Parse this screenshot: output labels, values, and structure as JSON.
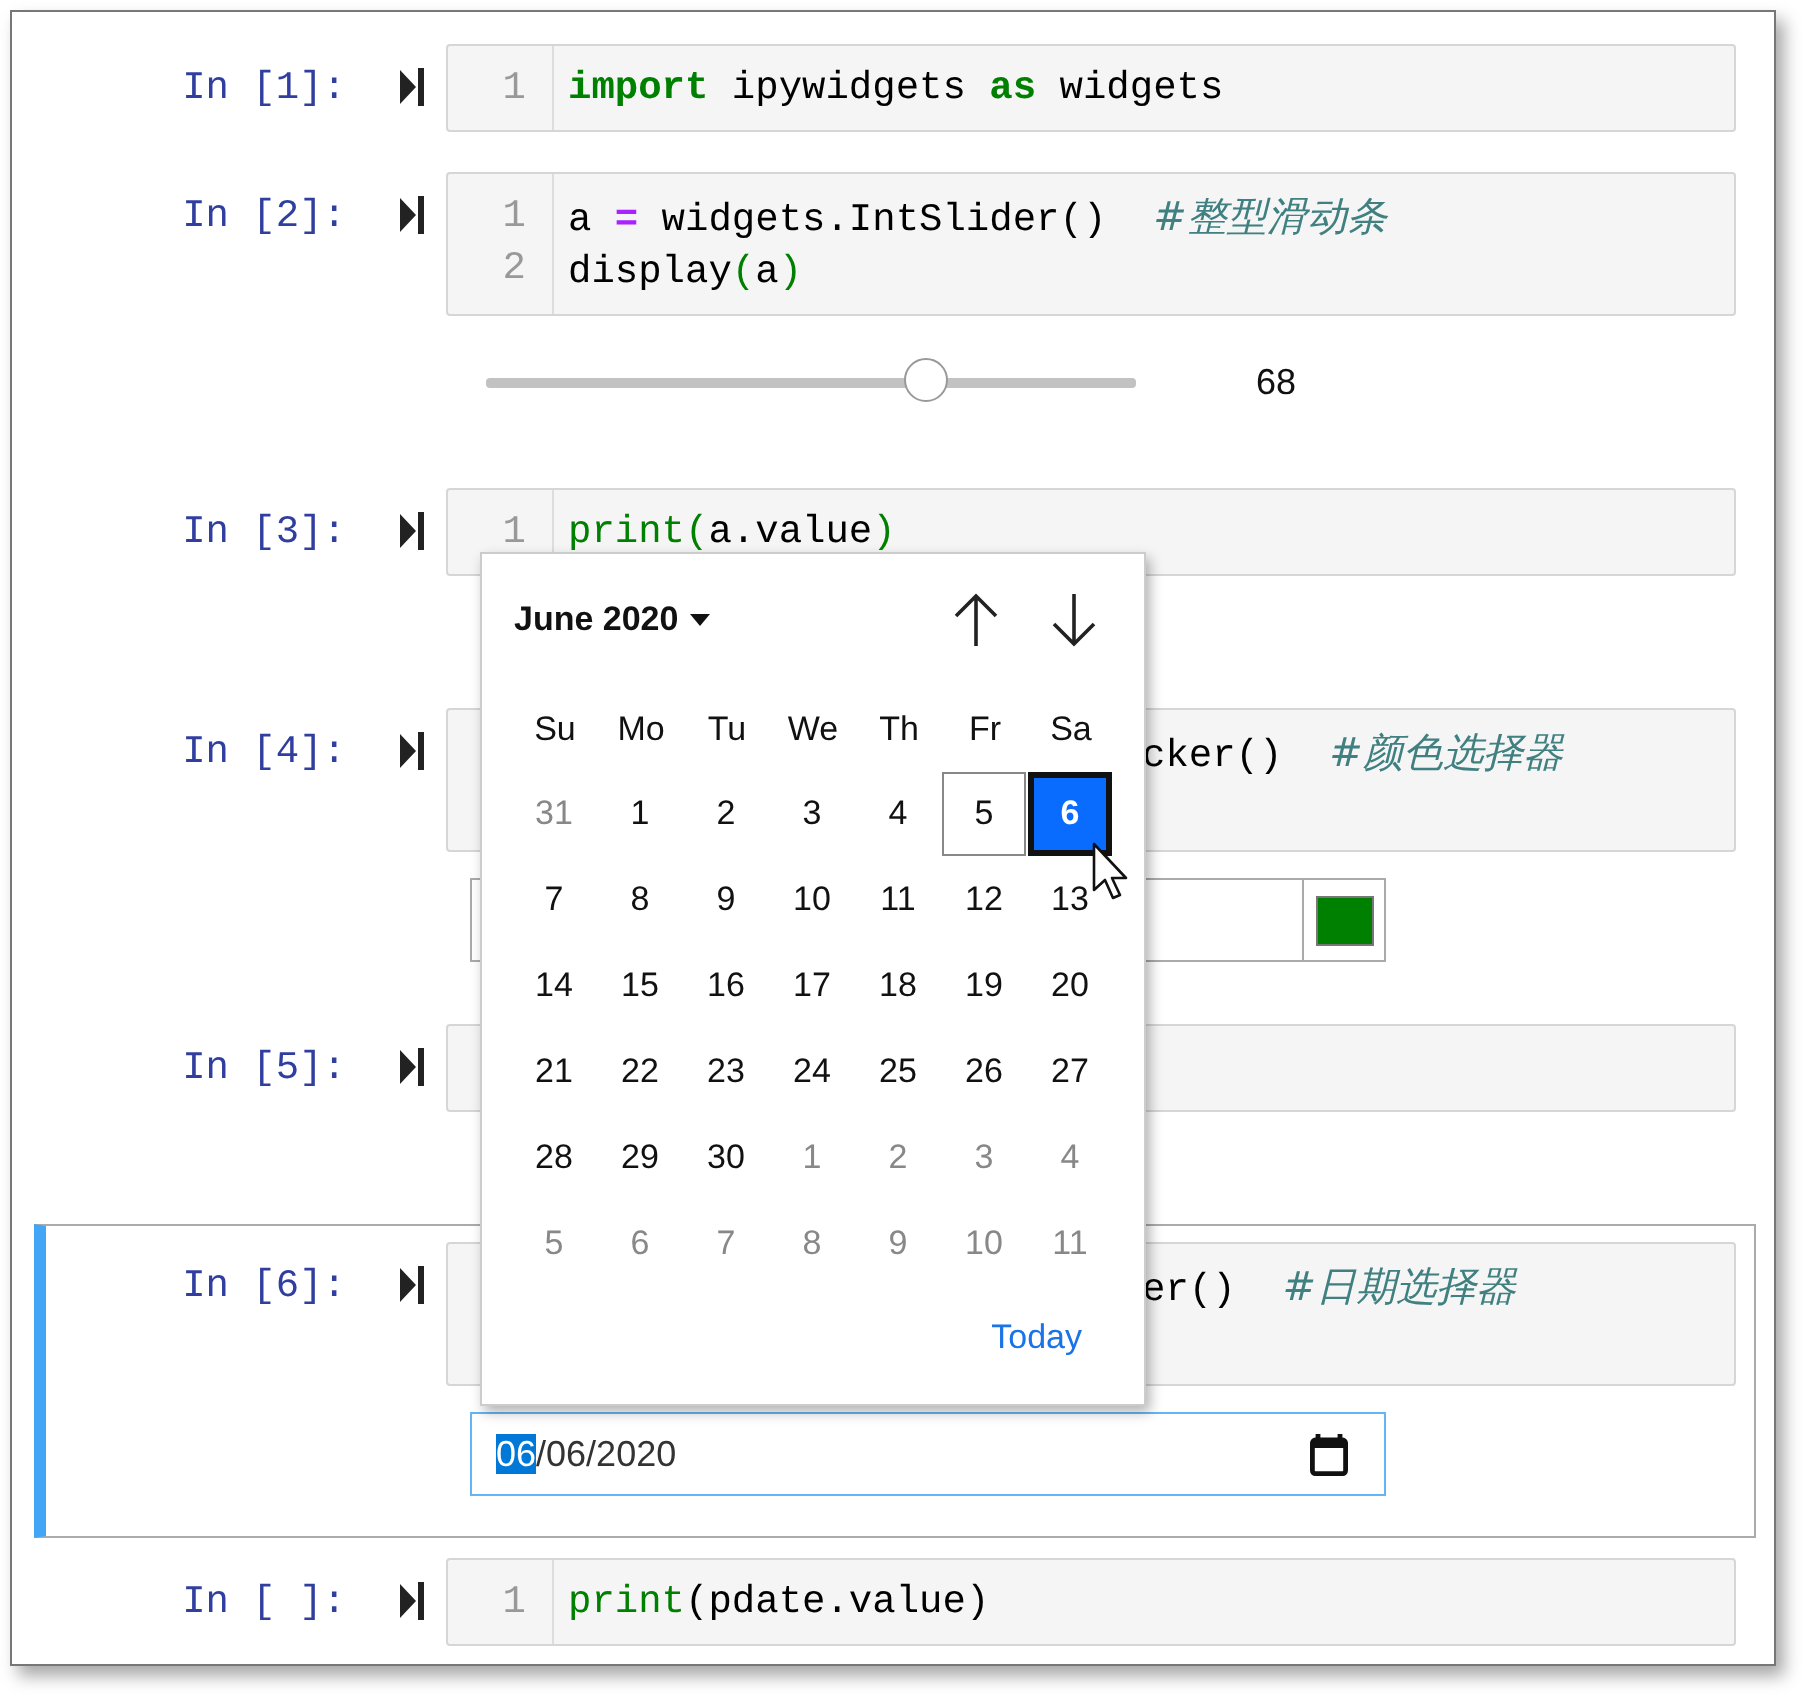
{
  "cells": [
    {
      "prompt": "In [1]:",
      "selected": false,
      "kind": "code",
      "lines": [
        {
          "number": "1",
          "tokens": [
            {
              "t": "import",
              "kind": "keyword"
            },
            {
              "t": " ipywidgets ",
              "kind": "plain"
            },
            {
              "t": "as",
              "kind": "keyword"
            },
            {
              "t": " widgets",
              "kind": "plain"
            }
          ]
        }
      ],
      "output": {
        "kind": "none"
      }
    },
    {
      "prompt": "In [2]:",
      "selected": false,
      "kind": "code",
      "lines": [
        {
          "number": "1",
          "tokens": [
            {
              "t": "a ",
              "kind": "plain"
            },
            {
              "t": "=",
              "kind": "operator"
            },
            {
              "t": " widgets.IntSlider()  ",
              "kind": "plain"
            },
            {
              "t": "#整型滑动条",
              "kind": "comment"
            }
          ]
        },
        {
          "number": "2",
          "tokens": [
            {
              "t": "display",
              "kind": "plain"
            },
            {
              "t": "(",
              "kind": "paren"
            },
            {
              "t": "a",
              "kind": "plain"
            },
            {
              "t": ")",
              "kind": "paren"
            }
          ]
        }
      ],
      "output": {
        "kind": "slider",
        "level": 0.68,
        "reading": "68"
      }
    },
    {
      "prompt": "In [3]:",
      "selected": false,
      "kind": "code",
      "lines": [
        {
          "number": "1",
          "tokens": [
            {
              "t": "print",
              "kind": "builtin"
            },
            {
              "t": "(",
              "kind": "paren"
            },
            {
              "t": "a.value",
              "kind": "plain"
            },
            {
              "t": ")",
              "kind": "paren"
            }
          ]
        }
      ],
      "output": {
        "kind": "hidden"
      }
    },
    {
      "prompt": "In [4]:",
      "selected": false,
      "kind": "covered",
      "tall": true,
      "lines": [
        {
          "tokens": [
            {
              "t": "cker()  ",
              "kind": "plain"
            },
            {
              "t": "#颜色选择器",
              "kind": "comment"
            }
          ]
        }
      ],
      "output": {
        "kind": "color",
        "color": "#008000"
      }
    },
    {
      "prompt": "In [5]:",
      "selected": false,
      "kind": "covered",
      "tall": false,
      "output": {
        "kind": "hidden"
      }
    },
    {
      "prompt": "In [6]:",
      "selected": true,
      "kind": "covered",
      "tall": true,
      "lines": [
        {
          "tokens": [
            {
              "t": "er()  ",
              "kind": "plain"
            },
            {
              "t": "#日期选择器",
              "kind": "comment"
            }
          ]
        }
      ],
      "output": {
        "kind": "date",
        "segments": [
          {
            "text": "06",
            "selected": true
          },
          {
            "text": "/06/2020",
            "selected": false
          }
        ]
      }
    },
    {
      "prompt": "In [ ]:",
      "selected": false,
      "kind": "code",
      "lines": [
        {
          "number": "1",
          "tokens": [
            {
              "t": "print",
              "kind": "builtin"
            },
            {
              "t": "(pdate.value)",
              "kind": "plain"
            }
          ]
        }
      ],
      "output": {
        "kind": "none"
      }
    }
  ],
  "date_picker": {
    "month": "June 2020",
    "weekdays": [
      "Su",
      "Mo",
      "Tu",
      "We",
      "Th",
      "Fr",
      "Sa"
    ],
    "days": [
      {
        "label": "31",
        "muted": true,
        "today": false,
        "selected": false
      },
      {
        "label": "1",
        "muted": false,
        "today": false,
        "selected": false
      },
      {
        "label": "2",
        "muted": false,
        "today": false,
        "selected": false
      },
      {
        "label": "3",
        "muted": false,
        "today": false,
        "selected": false
      },
      {
        "label": "4",
        "muted": false,
        "today": false,
        "selected": false
      },
      {
        "label": "5",
        "muted": false,
        "today": true,
        "selected": false
      },
      {
        "label": "6",
        "muted": false,
        "today": false,
        "selected": true
      },
      {
        "label": "7",
        "muted": false,
        "today": false,
        "selected": false
      },
      {
        "label": "8",
        "muted": false,
        "today": false,
        "selected": false
      },
      {
        "label": "9",
        "muted": false,
        "today": false,
        "selected": false
      },
      {
        "label": "10",
        "muted": false,
        "today": false,
        "selected": false
      },
      {
        "label": "11",
        "muted": false,
        "today": false,
        "selected": false
      },
      {
        "label": "12",
        "muted": false,
        "today": false,
        "selected": false
      },
      {
        "label": "13",
        "muted": false,
        "today": false,
        "selected": false
      },
      {
        "label": "14",
        "muted": false,
        "today": false,
        "selected": false
      },
      {
        "label": "15",
        "muted": false,
        "today": false,
        "selected": false
      },
      {
        "label": "16",
        "muted": false,
        "today": false,
        "selected": false
      },
      {
        "label": "17",
        "muted": false,
        "today": false,
        "selected": false
      },
      {
        "label": "18",
        "muted": false,
        "today": false,
        "selected": false
      },
      {
        "label": "19",
        "muted": false,
        "today": false,
        "selected": false
      },
      {
        "label": "20",
        "muted": false,
        "today": false,
        "selected": false
      },
      {
        "label": "21",
        "muted": false,
        "today": false,
        "selected": false
      },
      {
        "label": "22",
        "muted": false,
        "today": false,
        "selected": false
      },
      {
        "label": "23",
        "muted": false,
        "today": false,
        "selected": false
      },
      {
        "label": "24",
        "muted": false,
        "today": false,
        "selected": false
      },
      {
        "label": "25",
        "muted": false,
        "today": false,
        "selected": false
      },
      {
        "label": "26",
        "muted": false,
        "today": false,
        "selected": false
      },
      {
        "label": "27",
        "muted": false,
        "today": false,
        "selected": false
      },
      {
        "label": "28",
        "muted": false,
        "today": false,
        "selected": false
      },
      {
        "label": "29",
        "muted": false,
        "today": false,
        "selected": false
      },
      {
        "label": "30",
        "muted": false,
        "today": false,
        "selected": false
      },
      {
        "label": "1",
        "muted": true,
        "today": false,
        "selected": false
      },
      {
        "label": "2",
        "muted": true,
        "today": false,
        "selected": false
      },
      {
        "label": "3",
        "muted": true,
        "today": false,
        "selected": false
      },
      {
        "label": "4",
        "muted": true,
        "today": false,
        "selected": false
      },
      {
        "label": "5",
        "muted": true,
        "today": false,
        "selected": false
      },
      {
        "label": "6",
        "muted": true,
        "today": false,
        "selected": false
      },
      {
        "label": "7",
        "muted": true,
        "today": false,
        "selected": false
      },
      {
        "label": "8",
        "muted": true,
        "today": false,
        "selected": false
      },
      {
        "label": "9",
        "muted": true,
        "today": false,
        "selected": false
      },
      {
        "label": "10",
        "muted": true,
        "today": false,
        "selected": false
      },
      {
        "label": "11",
        "muted": true,
        "today": false,
        "selected": false
      }
    ],
    "today_link": "Today"
  }
}
